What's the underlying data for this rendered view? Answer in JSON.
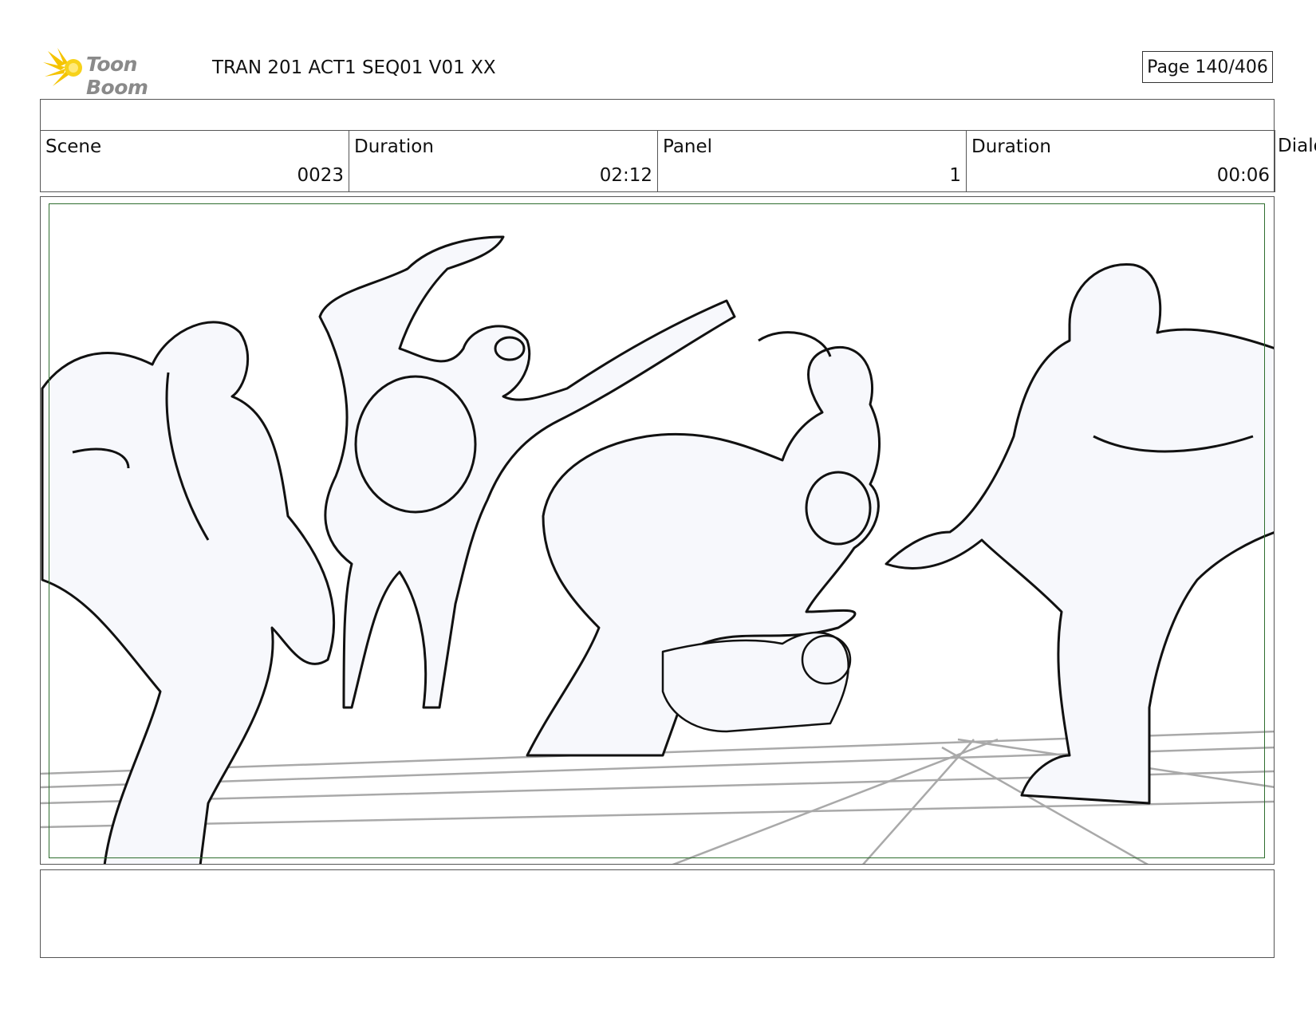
{
  "header": {
    "logo_text": "Toon Boom",
    "doc_title": "TRAN 201 ACT1 SEQ01 V01 XX",
    "page_label": "Page 140/406"
  },
  "info": {
    "scene_label": "Scene",
    "scene_value": "0023",
    "scene_duration_label": "Duration",
    "scene_duration_value": "02:12",
    "panel_label": "Panel",
    "panel_value": "1",
    "panel_duration_label": "Duration",
    "panel_duration_value": "00:06",
    "dialog_label": "Dialog"
  },
  "colors": {
    "safe_frame": "#2f6e2f",
    "logo_accent": "#f5c400"
  },
  "panel": {
    "image": "rough pencil storyboard sketch of a brawl"
  },
  "notes": {
    "text": ""
  }
}
